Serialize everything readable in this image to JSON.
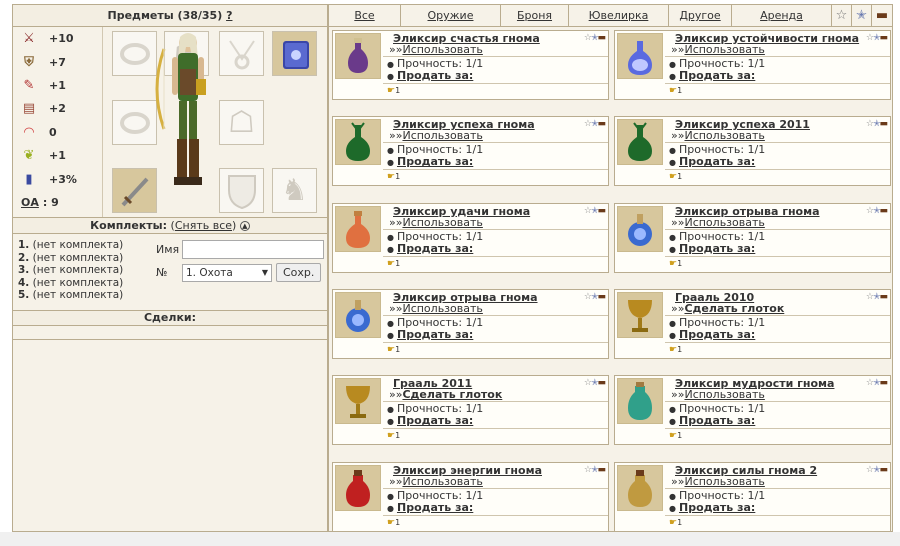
{
  "left": {
    "title": "Предметы (38/35)",
    "help": "?",
    "stats": [
      {
        "icon": "sword-icon",
        "glyph": "⚔",
        "value": "+10"
      },
      {
        "icon": "shield-icon",
        "glyph": "⛨",
        "value": "+7"
      },
      {
        "icon": "wand-icon",
        "glyph": "✎",
        "value": "+1"
      },
      {
        "icon": "book-icon",
        "glyph": "▤",
        "value": "+2"
      },
      {
        "icon": "rainbow-icon",
        "glyph": "◠",
        "value": "0"
      },
      {
        "icon": "wings-icon",
        "glyph": "❦",
        "value": "+1"
      },
      {
        "icon": "potion-icon",
        "glyph": "▮",
        "value": "+3%"
      }
    ],
    "oa_label": "ОА",
    "oa_value": ": 9",
    "sets_title": "Комплекты:",
    "sets_remove": "Снять все",
    "sets": [
      {
        "num": "1.",
        "label": "(нет комплекта)"
      },
      {
        "num": "2.",
        "label": "(нет комплекта)"
      },
      {
        "num": "3.",
        "label": "(нет комплекта)"
      },
      {
        "num": "4.",
        "label": "(нет комплекта)"
      },
      {
        "num": "5.",
        "label": "(нет комплекта)"
      }
    ],
    "name_label": "Имя",
    "name_value": "",
    "num_label": "№",
    "num_selected": "1. Охота",
    "save_label": "Сохр.",
    "deals_title": "Сделки:"
  },
  "tabs": [
    "Все",
    "Оружие",
    "Броня",
    "Ювелирка",
    "Другое",
    "Аренда"
  ],
  "colors": {
    "panel": "#f6f2e8",
    "border": "#b9ac8f",
    "thumb": "#d7c79d"
  },
  "items": [
    {
      "title": "Эликсир счастья гнома",
      "action": "Использовать",
      "durability": "Прочность: 1/1",
      "sell": "Продать за:",
      "count": "1",
      "icon": "purple-potion-icon"
    },
    {
      "title": "Эликсир устойчивости гнома",
      "action": "Использовать",
      "durability": "Прочность: 1/1",
      "sell": "Продать за:",
      "count": "1",
      "icon": "blue-potion-icon"
    },
    {
      "title": "Эликсир успеха гнома",
      "action": "Использовать",
      "durability": "Прочность: 1/1",
      "sell": "Продать за:",
      "count": "1",
      "icon": "green-potion-icon"
    },
    {
      "title": "Эликсир успеха 2011",
      "action": "Использовать",
      "durability": "Прочность: 1/1",
      "sell": "Продать за:",
      "count": "1",
      "icon": "green-potion-icon"
    },
    {
      "title": "Эликсир удачи гнома",
      "action": "Использовать",
      "durability": "Прочность: 1/1",
      "sell": "Продать за:",
      "count": "1",
      "icon": "red-potion-icon"
    },
    {
      "title": "Эликсир отрыва гнома",
      "action": "Использовать",
      "durability": "Прочность: 1/1",
      "sell": "Продать за:",
      "count": "1",
      "icon": "blue-flask-icon"
    },
    {
      "title": "Эликсир отрыва гнома",
      "action": "Использовать",
      "durability": "Прочность: 1/1",
      "sell": "Продать за:",
      "count": "1",
      "icon": "blue-flask-icon"
    },
    {
      "title": "Грааль 2010",
      "action": "Сделать глоток",
      "durability": "Прочность: 1/1",
      "sell": "Продать за:",
      "count": "1",
      "icon": "grail-icon"
    },
    {
      "title": "Грааль 2011",
      "action": "Сделать глоток",
      "durability": "Прочность: 1/1",
      "sell": "Продать за:",
      "count": "1",
      "icon": "grail-icon"
    },
    {
      "title": "Эликсир мудрости гнома",
      "action": "Использовать",
      "durability": "Прочность: 1/1",
      "sell": "Продать за:",
      "count": "1",
      "icon": "teal-potion-icon"
    },
    {
      "title": "Эликсир энергии гнома",
      "action": "Использовать",
      "durability": "Прочность: 1/1",
      "sell": "Продать за:",
      "count": "1",
      "icon": "red-bottle-icon"
    },
    {
      "title": "Эликсир силы гнома 2",
      "action": "Использовать",
      "durability": "Прочность: 1/1",
      "sell": "Продать за:",
      "count": "1",
      "icon": "gold-bottle-icon"
    }
  ]
}
